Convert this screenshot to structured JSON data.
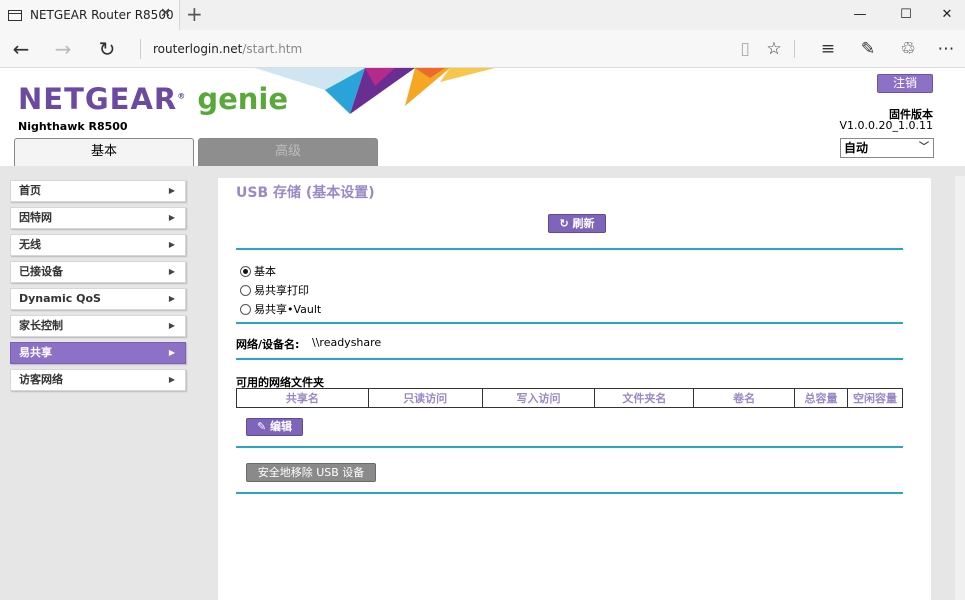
{
  "browser": {
    "tab_title": "NETGEAR Router R8500",
    "new_tab": "+",
    "url_host": "routerlogin.net",
    "url_path": "/start.htm",
    "window_controls": {
      "minimize": "—",
      "maximize": "☐",
      "close": "✕"
    },
    "nav": {
      "back": "←",
      "forward": "→",
      "reload": "↻"
    },
    "toolbar_icons": [
      "reading-view-icon",
      "favorite-star-icon",
      "hub-icon",
      "web-note-icon",
      "share-icon",
      "more-icon"
    ]
  },
  "router": {
    "brand": "NETGEAR",
    "product": "genie",
    "model": "Nighthawk R8500",
    "logout_label": "注销",
    "firmware_label": "固件版本",
    "firmware_version": "V1.0.0.20_1.0.11",
    "language_selected": "自动",
    "tabs": [
      {
        "label": "基本",
        "active": true
      },
      {
        "label": "高级",
        "active": false
      }
    ],
    "colors": {
      "accent": "#8d71c6",
      "rule": "#2aa6c4",
      "brand_purple": "#6d4aa1",
      "genie_green": "#58a83a"
    }
  },
  "sidebar": {
    "items": [
      {
        "label": "首页",
        "active": false
      },
      {
        "label": "因特网",
        "active": false
      },
      {
        "label": "无线",
        "active": false
      },
      {
        "label": "已接设备",
        "active": false
      },
      {
        "label": "Dynamic QoS",
        "active": false
      },
      {
        "label": "家长控制",
        "active": false
      },
      {
        "label": "易共享",
        "active": true
      },
      {
        "label": "访客网络",
        "active": false
      }
    ]
  },
  "page": {
    "title": "USB 存储 (基本设置)",
    "refresh_label": "刷新",
    "modes": [
      {
        "label": "基本",
        "selected": true
      },
      {
        "label": "易共享打印",
        "selected": false
      },
      {
        "label": "易共享•Vault",
        "selected": false
      }
    ],
    "device_name_label": "网络/设备名:",
    "device_name_value": "\\\\readyshare",
    "folders_label": "可用的网络文件夹",
    "folder_columns": [
      "共享名",
      "只读访问",
      "写入访问",
      "文件夹名",
      "卷名",
      "总容量",
      "空闲容量"
    ],
    "edit_label": "编辑",
    "safe_remove_label": "安全地移除 USB 设备"
  }
}
